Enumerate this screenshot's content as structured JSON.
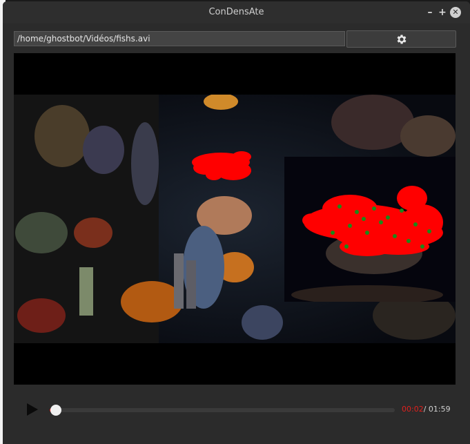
{
  "window": {
    "title": "ConDensAte",
    "minimize_glyph": "–",
    "maximize_glyph": "+",
    "close_glyph": "✕"
  },
  "file": {
    "path": "/home/ghostbot/Vidéos/fishs.avi"
  },
  "icons": {
    "settings": "gear-icon",
    "play": "play-icon"
  },
  "player": {
    "current_time": "00:02",
    "separator": "/ ",
    "total_time": "01:59",
    "progress_fraction": 0.017
  },
  "colors": {
    "accent": "#e0201d",
    "detection": "#ff0000",
    "tracking_points": "#1a8a1a",
    "background": "#2b2b2b"
  }
}
